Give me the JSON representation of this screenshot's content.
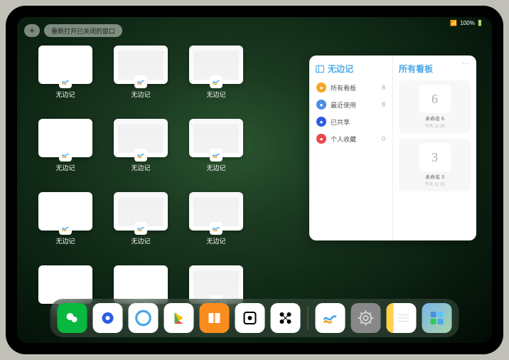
{
  "statusbar": {
    "signal": "📶",
    "battery": "100% 🔋"
  },
  "topbar": {
    "add": "+",
    "reopen": "重新打开已关闭的窗口"
  },
  "appLabel": "无边记",
  "windows": [
    {
      "style": "blank"
    },
    {
      "style": "cal"
    },
    {
      "style": "cal"
    },
    {
      "style": "blank"
    },
    {
      "style": "cal"
    },
    {
      "style": "cal"
    },
    {
      "style": "blank"
    },
    {
      "style": "cal"
    },
    {
      "style": "cal"
    },
    {
      "style": "blank"
    },
    {
      "style": "blank"
    },
    {
      "style": "cal"
    }
  ],
  "panel": {
    "leftTitle": "无边记",
    "items": [
      {
        "icon": "i1",
        "label": "所有看板",
        "count": "8"
      },
      {
        "icon": "i2",
        "label": "最近使用",
        "count": "8"
      },
      {
        "icon": "i3",
        "label": "已共享",
        "count": ""
      },
      {
        "icon": "i4",
        "label": "个人收藏",
        "count": "0"
      }
    ],
    "rightTitle": "所有看板",
    "boards": [
      {
        "glyph": "6",
        "label": "未命名 6",
        "sub": "今天 11:26"
      },
      {
        "glyph": "3",
        "label": "未命名 3",
        "sub": "今天 11:25"
      }
    ]
  },
  "dock": {
    "apps": [
      "wechat",
      "browser-q",
      "quark",
      "play",
      "books",
      "dice",
      "connect"
    ],
    "suggest": [
      "freeform",
      "settings",
      "notes",
      "recent"
    ]
  }
}
